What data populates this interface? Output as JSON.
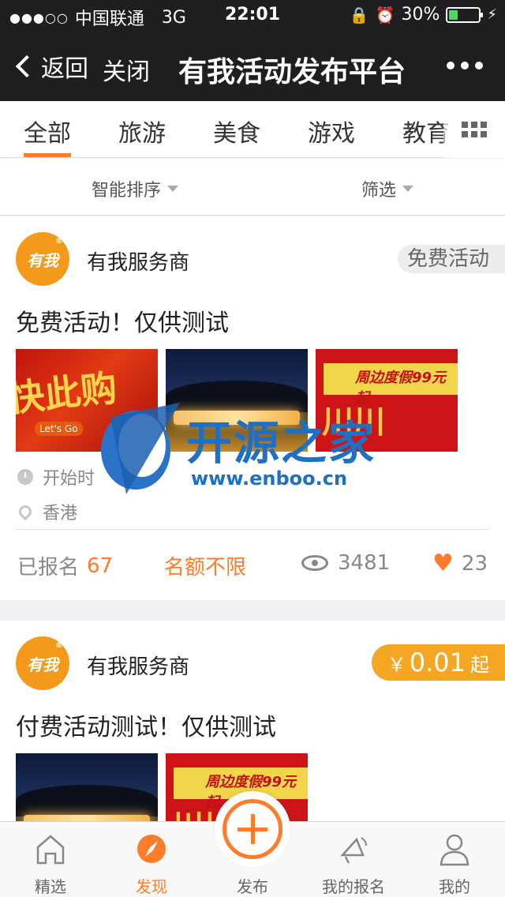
{
  "status_bar": {
    "signal": "●●●○○",
    "carrier": "中国联通",
    "network": "3G",
    "time": "22:01",
    "battery": "30%"
  },
  "nav": {
    "back_label": "返回",
    "close_label": "关闭",
    "title": "有我活动发布平台"
  },
  "tabs": [
    "全部",
    "旅游",
    "美食",
    "游戏",
    "教育"
  ],
  "filters": {
    "sort_label": "智能排序",
    "filter_label": "筛选"
  },
  "cards": [
    {
      "avatar_text": "有我",
      "provider": "有我服务商",
      "badge": "免费活动",
      "title": "免费活动！仅供测试",
      "thumb1_text": "快此购",
      "thumb1_tag": "Let's Go",
      "thumb3_text": "周边度假99元起",
      "start_label": "开始时",
      "location": "香港",
      "registered_label": "已报名",
      "registered_count": "67",
      "quota": "名额不限",
      "views": "3481",
      "likes": "23"
    },
    {
      "avatar_text": "有我",
      "provider": "有我服务商",
      "price_currency": "￥",
      "price_amount": "0.01",
      "price_suffix": "起",
      "title": "付费活动测试！仅供测试",
      "thumb3_text": "周边度假99元起"
    }
  ],
  "watermark": {
    "text": "开源之家",
    "url": "www.enboo.cn"
  },
  "tabbar": {
    "items": [
      "精选",
      "发现",
      "发布",
      "我的报名",
      "我的"
    ],
    "active": "发现"
  },
  "colors": {
    "accent": "#ff7d2a",
    "nav_bg": "#1f1f21",
    "price_badge": "#f5a623"
  }
}
